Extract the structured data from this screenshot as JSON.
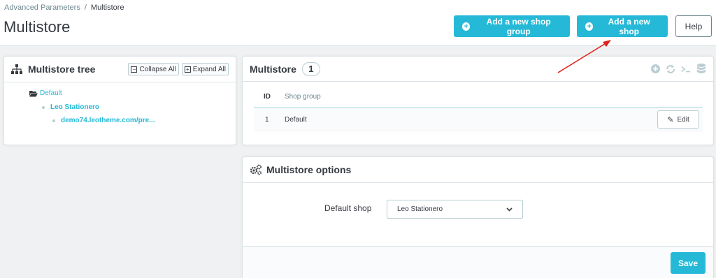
{
  "breadcrumb": {
    "parent": "Advanced Parameters",
    "separator": "/",
    "current": "Multistore"
  },
  "page_title": "Multistore",
  "toolbar": {
    "add_shop_group_label": "Add a new shop group",
    "add_shop_label": "Add a new shop",
    "help_label": "Help"
  },
  "tree_panel": {
    "title": "Multistore tree",
    "collapse_label": "Collapse All",
    "expand_label": "Expand All",
    "nodes": [
      {
        "label": "Default"
      },
      {
        "label": "Leo Stationero"
      },
      {
        "label": "demo74.leotheme.com/pre..."
      }
    ]
  },
  "multistore_panel": {
    "title": "Multistore",
    "count": "1",
    "columns": {
      "id": "ID",
      "shop_group": "Shop group"
    },
    "rows": [
      {
        "id": "1",
        "shop_group": "Default",
        "action": "Edit"
      }
    ]
  },
  "options_panel": {
    "title": "Multistore options",
    "default_shop_label": "Default shop",
    "default_shop_value": "Leo Stationero",
    "save_label": "Save"
  },
  "colors": {
    "accent": "#25b9d7",
    "annotation_arrow": "#e0201a"
  },
  "icons": [
    "sitemap-icon",
    "plus-circle-icon",
    "refresh-icon",
    "terminal-icon",
    "database-icon",
    "cogs-icon",
    "folder-open-icon",
    "pencil-icon",
    "chevron-down-icon"
  ]
}
